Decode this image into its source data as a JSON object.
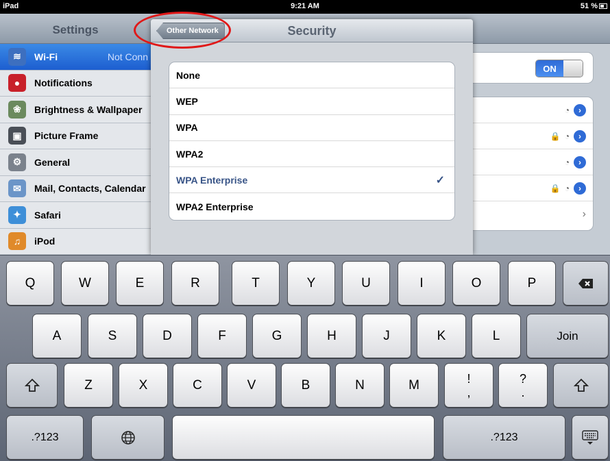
{
  "status_bar": {
    "carrier": "iPad",
    "time": "9:21 AM",
    "battery": "51 %"
  },
  "settings": {
    "title": "Settings",
    "items": [
      {
        "label": "Wi-Fi",
        "value": "Not Conn",
        "icon": "wifi-icon"
      },
      {
        "label": "Notifications",
        "icon": "notifications-icon"
      },
      {
        "label": "Brightness & Wallpaper",
        "icon": "brightness-icon"
      },
      {
        "label": "Picture Frame",
        "icon": "picture-frame-icon"
      },
      {
        "label": "General",
        "icon": "gear-icon"
      },
      {
        "label": "Mail, Contacts, Calendar",
        "icon": "mail-icon"
      },
      {
        "label": "Safari",
        "icon": "safari-icon"
      },
      {
        "label": "iPod",
        "icon": "ipod-icon"
      }
    ]
  },
  "wifi_detail": {
    "toggle": "ON"
  },
  "popover": {
    "back_label": "Other Network",
    "title": "Security",
    "options": [
      "None",
      "WEP",
      "WPA",
      "WPA2",
      "WPA Enterprise",
      "WPA2 Enterprise"
    ],
    "selected": "WPA Enterprise",
    "check": "✓"
  },
  "keyboard": {
    "row1": [
      "Q",
      "W",
      "E",
      "R",
      "T",
      "Y",
      "U",
      "I",
      "O",
      "P"
    ],
    "row2": [
      "A",
      "S",
      "D",
      "F",
      "G",
      "H",
      "J",
      "K",
      "L"
    ],
    "join": "Join",
    "row3": [
      "Z",
      "X",
      "C",
      "V",
      "B",
      "N",
      "M"
    ],
    "punct1": {
      "top": "!",
      "bottom": ","
    },
    "punct2": {
      "top": "?",
      "bottom": "."
    },
    "numbers": ".?123"
  }
}
